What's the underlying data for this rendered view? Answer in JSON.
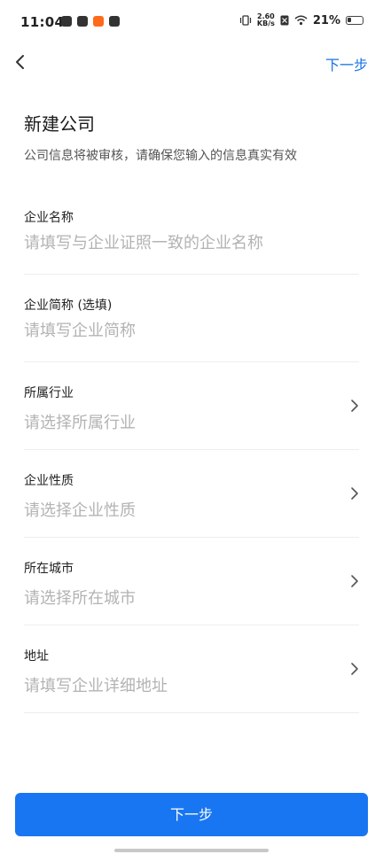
{
  "status_bar": {
    "time": "11:04",
    "net_speed_value": "2.60",
    "net_speed_unit": "KB/s",
    "battery": "21%"
  },
  "nav": {
    "next_label": "下一步"
  },
  "page": {
    "title": "新建公司",
    "subtitle": "公司信息将被审核，请确保您输入的信息真实有效"
  },
  "form": {
    "company_name": {
      "label": "企业名称",
      "placeholder": "请填写与企业证照一致的企业名称"
    },
    "company_short": {
      "label": "企业简称 (选填)",
      "placeholder": "请填写企业简称"
    },
    "industry": {
      "label": "所属行业",
      "placeholder": "请选择所属行业"
    },
    "nature": {
      "label": "企业性质",
      "placeholder": "请选择企业性质"
    },
    "city": {
      "label": "所在城市",
      "placeholder": "请选择所在城市"
    },
    "address": {
      "label": "地址",
      "placeholder": "请填写企业详细地址"
    }
  },
  "footer": {
    "next_button": "下一步"
  },
  "colors": {
    "accent": "#1876f2",
    "link": "#1a73e8",
    "placeholder": "#b3b3b3"
  }
}
